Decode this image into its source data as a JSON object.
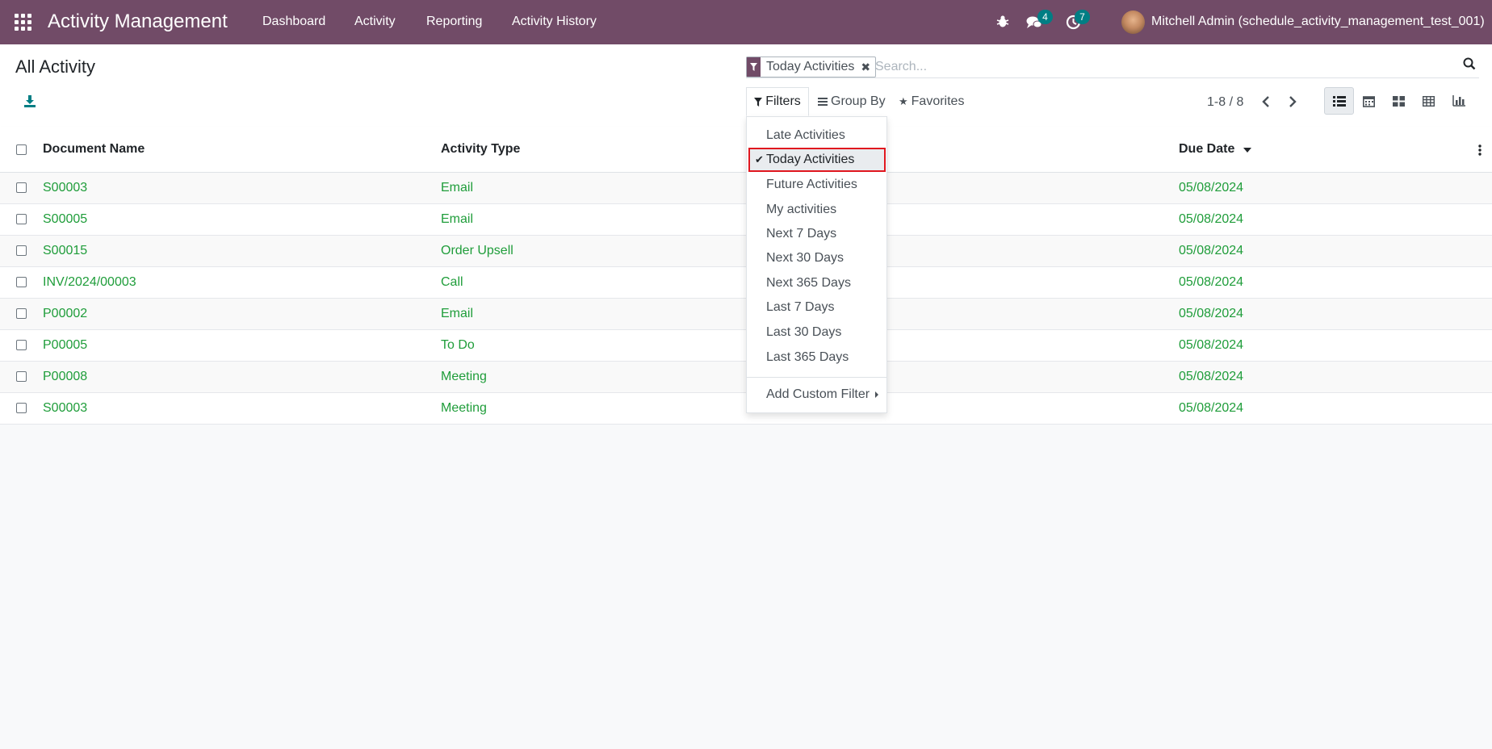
{
  "navbar": {
    "app_title": "Activity Management",
    "menu": [
      "Dashboard",
      "Activity",
      "Reporting",
      "Activity History"
    ],
    "messages_count": "4",
    "activities_count": "7",
    "user_name": "Mitchell Admin (schedule_activity_management_test_001)"
  },
  "control_panel": {
    "page_title": "All Activity",
    "facet_label": "Today Activities",
    "search_placeholder": "Search...",
    "filters_label": "Filters",
    "group_by_label": "Group By",
    "favorites_label": "Favorites",
    "pager": "1-8 / 8"
  },
  "list": {
    "columns": [
      "Document Name",
      "Activity Type",
      "Due Date"
    ],
    "rows": [
      {
        "document": "S00003",
        "type": "Email",
        "due": "05/08/2024"
      },
      {
        "document": "S00005",
        "type": "Email",
        "due": "05/08/2024"
      },
      {
        "document": "S00015",
        "type": "Order Upsell",
        "due": "05/08/2024"
      },
      {
        "document": "INV/2024/00003",
        "type": "Call",
        "due": "05/08/2024"
      },
      {
        "document": "P00002",
        "type": "Email",
        "due": "05/08/2024"
      },
      {
        "document": "P00005",
        "type": "To Do",
        "due": "05/08/2024"
      },
      {
        "document": "P00008",
        "type": "Meeting",
        "due": "05/08/2024"
      },
      {
        "document": "S00003",
        "type": "Meeting",
        "due": "05/08/2024"
      }
    ]
  },
  "filters_dropdown": {
    "items": [
      "Late Activities",
      "Today Activities",
      "Future Activities",
      "My activities",
      "Next 7 Days",
      "Next 30 Days",
      "Next 365 Days",
      "Last 7 Days",
      "Last 30 Days",
      "Last 365 Days"
    ],
    "selected": "Today Activities",
    "custom_filter": "Add Custom Filter"
  },
  "colors": {
    "brand": "#714b67",
    "badge": "#017e84",
    "link": "#1f9d3a",
    "highlight": "#e0171f"
  }
}
